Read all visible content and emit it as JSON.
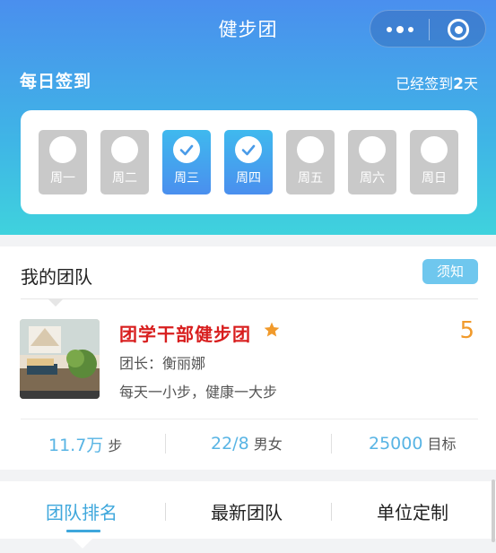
{
  "nav": {
    "title": "健步团"
  },
  "signin": {
    "title": "每日签到",
    "count_prefix": "已经签到",
    "count_value": "2",
    "count_suffix": "天",
    "days": [
      {
        "label": "周一",
        "checked": false
      },
      {
        "label": "周二",
        "checked": false
      },
      {
        "label": "周三",
        "checked": true
      },
      {
        "label": "周四",
        "checked": true
      },
      {
        "label": "周五",
        "checked": false
      },
      {
        "label": "周六",
        "checked": false
      },
      {
        "label": "周日",
        "checked": false
      }
    ]
  },
  "team": {
    "section_title": "我的团队",
    "notice_label": "须知",
    "name": "团学干部健步团",
    "rank": "5",
    "leader": "团长：衡丽娜",
    "slogan": "每天一小步，健康一大步",
    "stats": [
      {
        "value": "11.7万",
        "unit": "步"
      },
      {
        "value": "22/8",
        "unit": "男女"
      },
      {
        "value": "25000",
        "unit": "目标"
      }
    ]
  },
  "tabs": [
    {
      "label": "团队排名",
      "active": true
    },
    {
      "label": "最新团队",
      "active": false
    },
    {
      "label": "单位定制",
      "active": false
    }
  ],
  "colors": {
    "accent": "#3ea7dc",
    "team_name": "#d81e1e",
    "rank": "#f19a2b",
    "star": "#f19a2b"
  }
}
